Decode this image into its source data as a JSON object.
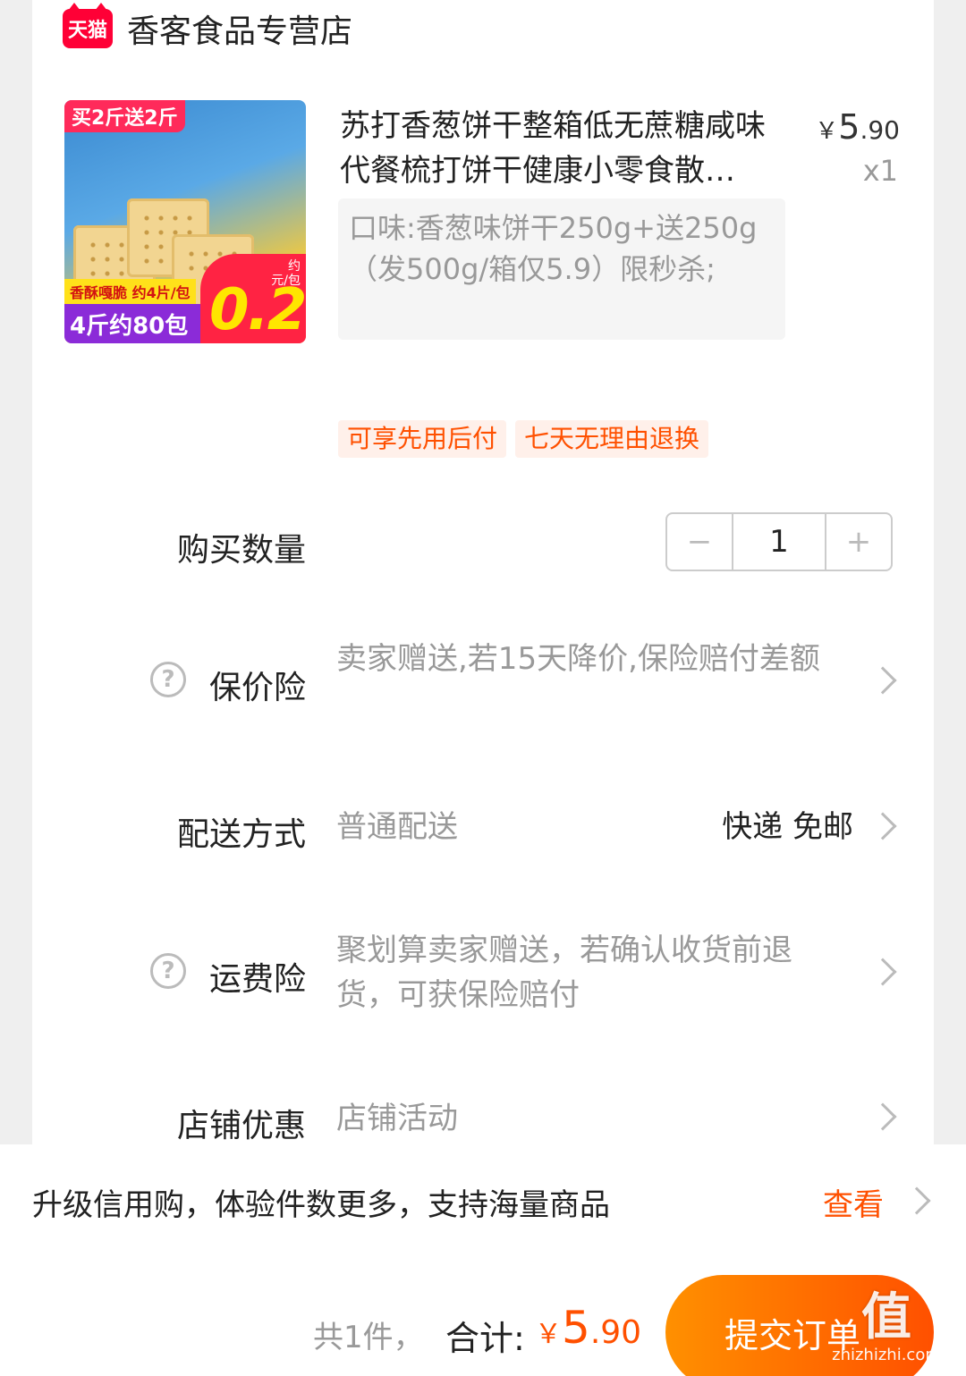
{
  "store": {
    "logo_text": "天猫",
    "name": "香客食品专营店"
  },
  "product": {
    "image_banner_top": "买2斤送2斤",
    "image_banner_mid": "香酥嘎脆 约4片/包",
    "image_banner_bottom": "4斤约80包",
    "image_price_big": "0.2",
    "image_price_small": "约\n元/包",
    "title": "苏打香葱饼干整箱低无蔗糖咸味代餐梳打饼干健康小零食散…",
    "price_currency": "￥",
    "price_int": "5",
    "price_dec": ".90",
    "quantity_label": "x1",
    "sku": "口味:香葱味饼干250g+送250g（发500g/箱仅5.9）限秒杀;"
  },
  "tags": [
    "可享先用后付",
    "七天无理由退换"
  ],
  "quantity": {
    "label": "购买数量",
    "minus": "−",
    "value": "1",
    "plus": "+"
  },
  "price_protection": {
    "label": "保价险",
    "value": "卖家赠送,若15天降价,保险赔付差额"
  },
  "delivery": {
    "label": "配送方式",
    "method": "普通配送",
    "value": "快递 免邮"
  },
  "shipping_insurance": {
    "label": "运费险",
    "value": "聚划算卖家赠送，若确认收货前退货，可获保险赔付"
  },
  "store_discount": {
    "label": "店铺优惠",
    "value": "店铺活动"
  },
  "credit": {
    "text": "升级信用购，体验件数更多，支持海量商品",
    "link": "查看"
  },
  "footer": {
    "count": "共1件，",
    "total_label": "合计:",
    "total_currency": "￥",
    "total_int": "5",
    "total_dec": ".90",
    "submit": "提交订单"
  },
  "watermark": {
    "mark": "值",
    "site": "zhizhizhi.com"
  },
  "colors": {
    "accent": "#ff5000",
    "tmall_red": "#ff0036",
    "tag_bg": "#fff0ea"
  }
}
